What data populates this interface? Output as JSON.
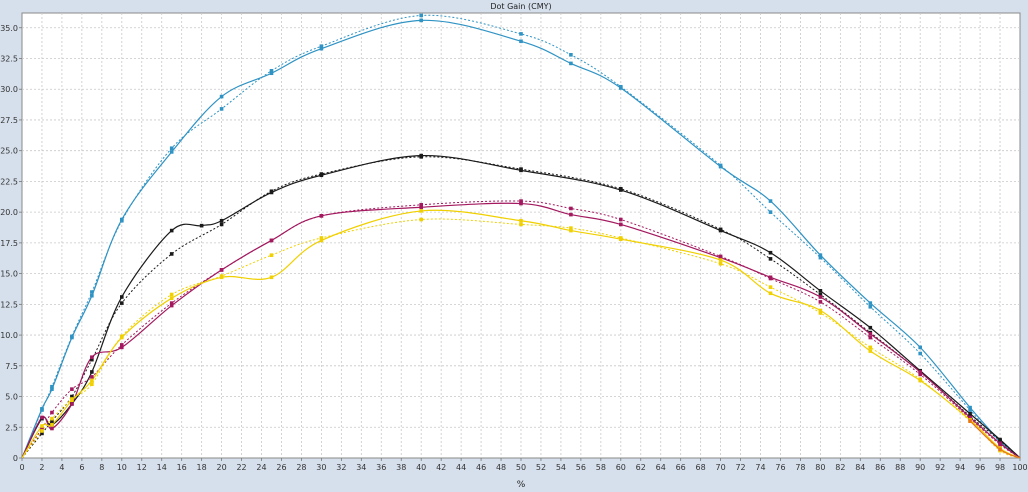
{
  "chart_data": {
    "type": "line",
    "title": "Dot Gain (CMY)",
    "xlabel": "%",
    "ylabel": "",
    "xlim": [
      0,
      100
    ],
    "ylim": [
      0,
      36.2
    ],
    "x_ticks": [
      0,
      2,
      4,
      6,
      8,
      10,
      12,
      14,
      16,
      18,
      20,
      22,
      24,
      26,
      28,
      30,
      32,
      34,
      36,
      38,
      40,
      42,
      44,
      46,
      48,
      50,
      52,
      54,
      56,
      58,
      60,
      62,
      64,
      66,
      68,
      70,
      72,
      74,
      76,
      78,
      80,
      82,
      84,
      86,
      88,
      90,
      92,
      94,
      96,
      98,
      100
    ],
    "y_ticks": [
      0,
      2.5,
      5.0,
      7.5,
      10.0,
      12.5,
      15.0,
      17.5,
      20.0,
      22.5,
      25.0,
      27.5,
      30.0,
      32.5,
      35.0
    ],
    "y_tick_labels": [
      "0",
      "2.5",
      "5.0",
      "7.5",
      "10.0",
      "12.5",
      "15.0",
      "17.5",
      "20.0",
      "22.5",
      "25.0",
      "27.5",
      "30.0",
      "32.5",
      "35.0"
    ],
    "grid": true,
    "colors": {
      "cyan": "#2f93c4",
      "black": "#1a1a1a",
      "magenta": "#a3185e",
      "yellow": "#f0d000",
      "orange": "#e8731c",
      "background": "#ffffff",
      "frame": "#d6e0ec",
      "grid": "#c8c8c8"
    },
    "series": [
      {
        "color_key": "cyan",
        "style": "solid",
        "x": [
          0,
          2,
          3,
          5,
          7,
          10,
          15,
          20,
          25,
          30,
          40,
          50,
          55,
          60,
          70,
          75,
          80,
          85,
          90,
          95,
          98,
          100
        ],
        "y": [
          0,
          4.0,
          5.6,
          9.8,
          13.2,
          19.4,
          24.9,
          29.4,
          31.3,
          33.3,
          35.6,
          33.9,
          32.1,
          30.1,
          23.7,
          20.9,
          16.5,
          12.6,
          9.0,
          4.1,
          1.4,
          0
        ]
      },
      {
        "color_key": "cyan",
        "style": "dotted",
        "x": [
          0,
          2,
          3,
          5,
          7,
          10,
          15,
          20,
          25,
          30,
          40,
          50,
          55,
          60,
          70,
          75,
          80,
          85,
          90,
          95,
          98,
          100
        ],
        "y": [
          0,
          3.9,
          5.8,
          9.9,
          13.5,
          19.3,
          25.2,
          28.4,
          31.5,
          33.5,
          36.0,
          34.5,
          32.8,
          30.2,
          23.8,
          20.0,
          16.3,
          12.3,
          8.5,
          3.9,
          1.3,
          0
        ]
      },
      {
        "color_key": "black",
        "style": "solid",
        "x": [
          0,
          2,
          3,
          5,
          7,
          10,
          15,
          18,
          20,
          25,
          30,
          40,
          50,
          60,
          70,
          75,
          80,
          85,
          90,
          95,
          98,
          100
        ],
        "y": [
          0,
          3.2,
          2.7,
          4.4,
          7.0,
          13.1,
          18.5,
          18.9,
          19.3,
          21.6,
          23.0,
          24.6,
          23.4,
          21.8,
          18.5,
          16.7,
          13.6,
          10.6,
          7.1,
          3.6,
          1.5,
          0
        ]
      },
      {
        "color_key": "black",
        "style": "dotted",
        "x": [
          0,
          2,
          3,
          5,
          7,
          10,
          15,
          20,
          25,
          30,
          40,
          50,
          60,
          70,
          75,
          80,
          85,
          90,
          95,
          98,
          100
        ],
        "y": [
          0,
          2.0,
          3.0,
          5.0,
          8.0,
          12.6,
          16.6,
          19.0,
          21.7,
          23.1,
          24.5,
          23.5,
          21.9,
          18.6,
          16.2,
          13.3,
          10.2,
          7.0,
          3.4,
          1.4,
          0
        ]
      },
      {
        "color_key": "magenta",
        "style": "solid",
        "x": [
          0,
          2,
          3,
          5,
          7,
          10,
          15,
          20,
          25,
          30,
          40,
          50,
          55,
          60,
          70,
          75,
          80,
          85,
          90,
          95,
          98,
          100
        ],
        "y": [
          0,
          3.3,
          2.4,
          4.4,
          8.2,
          9.0,
          12.4,
          15.3,
          17.7,
          19.7,
          20.4,
          20.7,
          19.8,
          19.0,
          16.3,
          14.7,
          13.1,
          10.1,
          7.0,
          3.3,
          1.2,
          0
        ]
      },
      {
        "color_key": "magenta",
        "style": "dotted",
        "x": [
          0,
          2,
          3,
          5,
          7,
          10,
          15,
          20,
          25,
          30,
          40,
          50,
          55,
          60,
          70,
          75,
          80,
          85,
          90,
          95,
          98,
          100
        ],
        "y": [
          0,
          2.4,
          3.7,
          5.6,
          6.6,
          9.2,
          12.6,
          15.3,
          17.7,
          19.7,
          20.6,
          20.9,
          20.3,
          19.4,
          16.4,
          14.6,
          12.7,
          9.8,
          6.8,
          3.2,
          1.1,
          0
        ]
      },
      {
        "color_key": "yellow",
        "style": "solid",
        "x": [
          0,
          2,
          3,
          5,
          7,
          10,
          15,
          20,
          25,
          30,
          40,
          50,
          55,
          60,
          70,
          75,
          80,
          85,
          90,
          95,
          98,
          100
        ],
        "y": [
          0,
          2.6,
          2.7,
          4.7,
          6.3,
          9.8,
          13.0,
          14.7,
          14.7,
          17.7,
          20.1,
          19.3,
          18.5,
          17.8,
          16.1,
          13.4,
          12.0,
          8.7,
          6.3,
          3.1,
          0.8,
          0
        ]
      },
      {
        "color_key": "yellow",
        "style": "dotted",
        "x": [
          0,
          2,
          3,
          5,
          7,
          10,
          15,
          20,
          25,
          30,
          40,
          50,
          55,
          60,
          70,
          75,
          80,
          85,
          90,
          95,
          98,
          100
        ],
        "y": [
          0,
          2.2,
          3.2,
          4.8,
          6.0,
          9.9,
          13.3,
          14.8,
          16.5,
          17.9,
          19.4,
          19.0,
          18.7,
          17.9,
          15.8,
          13.9,
          11.8,
          9.0,
          6.4,
          3.0,
          0.6,
          0
        ]
      },
      {
        "color_key": "orange",
        "style": "solid",
        "x": [
          95,
          98,
          100
        ],
        "y": [
          3.0,
          0.7,
          0
        ]
      }
    ]
  }
}
